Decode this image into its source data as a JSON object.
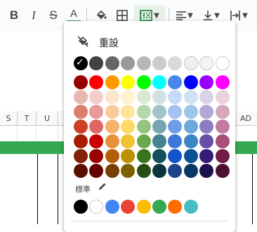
{
  "toolbar": {
    "bold_label": "B",
    "italic_label": "I",
    "strike_label": "S",
    "text_color_label": "A",
    "text_color_bar": "#34a853",
    "icons": [
      "fill-color-icon",
      "borders-icon",
      "merge-cells-icon",
      "horizontal-align-icon",
      "vertical-align-icon",
      "text-wrapping-icon"
    ]
  },
  "columns": [
    {
      "label": "S"
    },
    {
      "label": "T"
    },
    {
      "label": "U"
    },
    {
      "label": "AD"
    }
  ],
  "palette": {
    "reset_label": "重設",
    "standard_label": "標準",
    "selected_color": "#000000",
    "rows": [
      [
        "#000000",
        "#434343",
        "#666666",
        "#999999",
        "#b7b7b7",
        "#cccccc",
        "#d9d9d9",
        "#efefef",
        "#f3f3f3",
        "#ffffff"
      ],
      [
        "#980000",
        "#ff0000",
        "#ff9900",
        "#ffff00",
        "#00ff00",
        "#00ffff",
        "#4a86e8",
        "#0000ff",
        "#9900ff",
        "#ff00ff"
      ],
      [
        "#e6b8af",
        "#f4cccc",
        "#fce5cd",
        "#fff2cc",
        "#d9ead3",
        "#d0e0e3",
        "#c9daf8",
        "#cfe2f3",
        "#d9d2e9",
        "#ead1dc"
      ],
      [
        "#dd7e6b",
        "#ea9999",
        "#f9cb9c",
        "#ffe599",
        "#b6d7a8",
        "#a2c4c9",
        "#a4c2f4",
        "#9fc5e8",
        "#b4a7d6",
        "#d5a6bd"
      ],
      [
        "#cc4125",
        "#e06666",
        "#f6b26b",
        "#ffd966",
        "#93c47d",
        "#76a5af",
        "#6d9eeb",
        "#6fa8dc",
        "#8e7cc3",
        "#c27ba0"
      ],
      [
        "#a61c00",
        "#cc0000",
        "#e69138",
        "#f1c232",
        "#6aa84f",
        "#45818e",
        "#3c78d8",
        "#3d85c6",
        "#674ea7",
        "#a64d79"
      ],
      [
        "#85200c",
        "#990000",
        "#b45f06",
        "#bf9000",
        "#38761d",
        "#134f5c",
        "#1155cc",
        "#0b5394",
        "#351c75",
        "#741b47"
      ],
      [
        "#5b0f00",
        "#660000",
        "#783f04",
        "#7f6000",
        "#274e13",
        "#0c343d",
        "#1c4587",
        "#073763",
        "#20124d",
        "#4c1130"
      ]
    ],
    "standard": [
      "#000000",
      "#ffffff",
      "#4285f4",
      "#ea4335",
      "#fbbc04",
      "#34a853",
      "#ff6d01",
      "#46bdc6"
    ]
  }
}
